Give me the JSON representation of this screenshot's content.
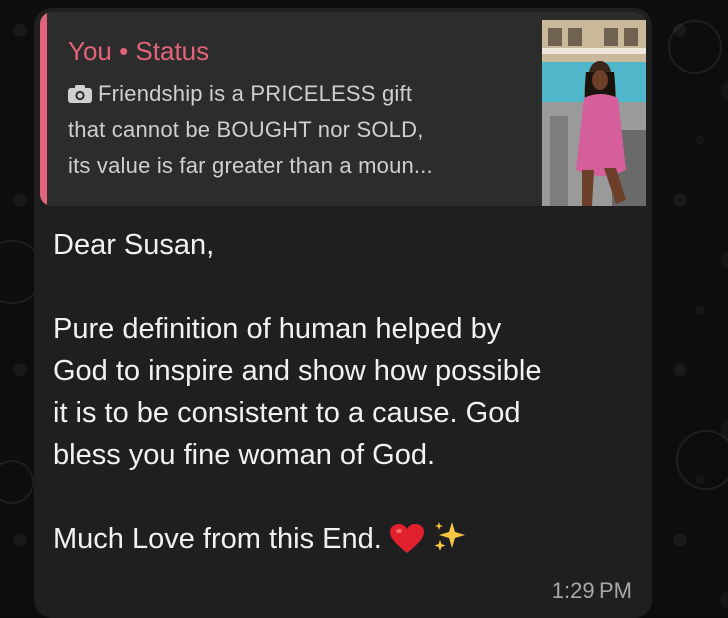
{
  "quote": {
    "title": "You • Status",
    "lines": [
      "Friendship is a PRICELESS gift",
      "that cannot be BOUGHT nor SOLD,",
      "its value is far greater than a moun..."
    ],
    "media_icon": "camera-icon",
    "accent_color": "#e2647a"
  },
  "message": {
    "greeting": "Dear Susan,",
    "body": "Pure definition of human helped by\nGod to inspire and show how possible\nit is to be consistent to a cause. God\nbless you fine woman of God.",
    "closing": "Much Love from this End."
  },
  "emojis": [
    "red-heart-icon",
    "sparkles-icon"
  ],
  "time": "1:29 PM",
  "colors": {
    "bubble": "#1f1f1f",
    "quote_bg": "#2c2c2c",
    "text": "#f2f2f2",
    "timestamp": "#a8a8a8"
  }
}
